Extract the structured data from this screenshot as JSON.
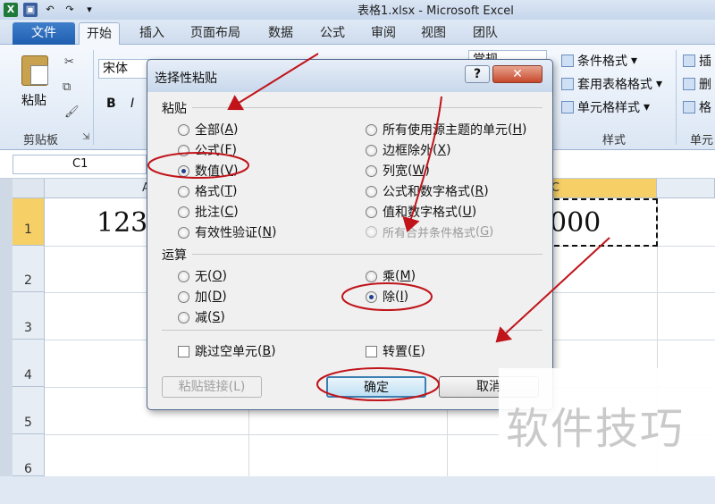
{
  "window": {
    "title": "表格1.xlsx - Microsoft Excel",
    "app_icon": "X"
  },
  "ribbon_tabs": [
    {
      "label": "文件"
    },
    {
      "label": "开始"
    },
    {
      "label": "插入"
    },
    {
      "label": "页面布局"
    },
    {
      "label": "数据"
    },
    {
      "label": "公式"
    },
    {
      "label": "审阅"
    },
    {
      "label": "视图"
    },
    {
      "label": "团队"
    }
  ],
  "ribbon": {
    "paste_label": "粘贴",
    "clipboard_group": "剪贴板",
    "font_name": "宋体",
    "bold": "B",
    "italic": "I",
    "number_format": "常规",
    "conditional_format": "条件格式",
    "table_format": "套用表格格式",
    "cell_styles": "单元格样式",
    "styles_group": "样式",
    "insert": "插",
    "delete": "删",
    "format": "格",
    "cells_group": "单元"
  },
  "formula_bar": {
    "name_box": "C1"
  },
  "sheet": {
    "columns": [
      "A",
      "C"
    ],
    "rows": [
      "1",
      "2",
      "3",
      "4",
      "5",
      "6"
    ],
    "cell_a1": "123",
    "cell_c1": "000"
  },
  "dialog": {
    "title": "选择性粘贴",
    "help": "?",
    "close": "✕",
    "paste_section": "粘贴",
    "paste_options_left": [
      {
        "label": "全部",
        "key": "A",
        "checked": false
      },
      {
        "label": "公式",
        "key": "F",
        "checked": false
      },
      {
        "label": "数值",
        "key": "V",
        "checked": true
      },
      {
        "label": "格式",
        "key": "T",
        "checked": false
      },
      {
        "label": "批注",
        "key": "C",
        "checked": false
      },
      {
        "label": "有效性验证",
        "key": "N",
        "checked": false
      }
    ],
    "paste_options_right": [
      {
        "label": "所有使用源主题的单元",
        "key": "H",
        "checked": false,
        "disabled": false
      },
      {
        "label": "边框除外",
        "key": "X",
        "checked": false,
        "disabled": false
      },
      {
        "label": "列宽",
        "key": "W",
        "checked": false,
        "disabled": false
      },
      {
        "label": "公式和数字格式",
        "key": "R",
        "checked": false,
        "disabled": false
      },
      {
        "label": "值和数字格式",
        "key": "U",
        "checked": false,
        "disabled": false
      },
      {
        "label": "所有合并条件格式",
        "key": "G",
        "checked": false,
        "disabled": true
      }
    ],
    "operation_section": "运算",
    "operation_left": [
      {
        "label": "无",
        "key": "O",
        "checked": false
      },
      {
        "label": "加",
        "key": "D",
        "checked": false
      },
      {
        "label": "减",
        "key": "S",
        "checked": false
      }
    ],
    "operation_right": [
      {
        "label": "乘",
        "key": "M",
        "checked": false
      },
      {
        "label": "除",
        "key": "I",
        "checked": true
      }
    ],
    "skip_blanks": {
      "label": "跳过空单元",
      "key": "B"
    },
    "transpose": {
      "label": "转置",
      "key": "E"
    },
    "paste_link": "粘贴链接(L)",
    "ok": "确定",
    "cancel": "取消"
  },
  "watermark": "软件技巧",
  "annotation_color": "#c0141a"
}
